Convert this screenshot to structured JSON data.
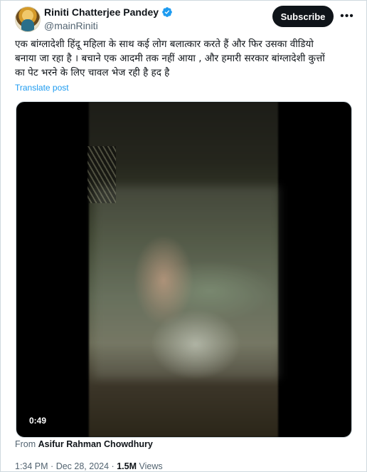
{
  "author": {
    "name": "Riniti Chatterjee Pandey",
    "handle": "@mainRiniti",
    "verified": true
  },
  "actions": {
    "subscribe_label": "Subscribe",
    "more_icon": "more-horizontal-icon"
  },
  "tweet": {
    "text": "एक बांग्लादेशी हिंदू महिला के साथ कई लोग बलात्कार करते हैं और फिर उसका वीडियो\nबनाया जा रहा है । बचाने एक आदमी तक नहीं आया , और हमारी सरकार बांग्लादेशी कुत्तों\nका पेट भरने के लिए चावल भेज रही है हद है",
    "translate_label": "Translate post"
  },
  "video": {
    "duration": "0:49"
  },
  "attribution": {
    "prefix": "From",
    "source": "Asifur Rahman Chowdhury"
  },
  "meta": {
    "time": "1:34 PM",
    "separator": "·",
    "date": "Dec 28, 2024",
    "views_count": "1.5M",
    "views_label": "Views"
  },
  "colors": {
    "accent": "#1d9bf0",
    "text": "#0f1419",
    "muted": "#536471",
    "subscribe_bg": "#0f1419"
  }
}
